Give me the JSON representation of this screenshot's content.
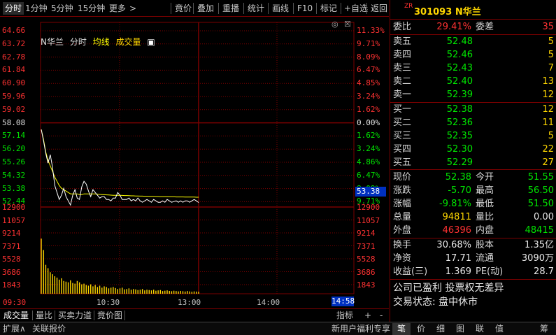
{
  "toolbar": {
    "items": [
      "分时",
      "1分钟",
      "5分钟",
      "15分钟",
      "更多",
      ">",
      "竟价",
      "叠加",
      "重播",
      "统计",
      "画线",
      "F10",
      "标记",
      "+自选",
      "返回"
    ]
  },
  "chart": {
    "legend": {
      "name": "N华兰",
      "mode": "分时",
      "avg": "均线",
      "vol": "成交量"
    },
    "price_labels": [
      "64.66",
      "63.72",
      "62.78",
      "61.84",
      "60.90",
      "59.96",
      "59.02",
      "58.08",
      "57.14",
      "56.20",
      "55.26",
      "54.32",
      "53.38",
      "52.44"
    ],
    "pct_labels": [
      "11.33%",
      "9.71%",
      "8.09%",
      "6.47%",
      "4.85%",
      "3.24%",
      "1.62%",
      "0.00%",
      "1.62%",
      "3.24%",
      "4.86%",
      "6.47%",
      "8.09%",
      "9.71%"
    ],
    "current_price_tag": "53.38",
    "vol_labels": [
      "12900",
      "11057",
      "9214",
      "7371",
      "5528",
      "3686",
      "1843"
    ],
    "vol_labels_right": [
      "12900",
      "11057",
      "9214",
      "7371",
      "5528",
      "3686",
      "1843"
    ],
    "time_labels": [
      "09:30",
      "10:30",
      "13:00",
      "14:00"
    ],
    "current_time_tag": "14:58"
  },
  "chart_data": {
    "type": "line",
    "title": "",
    "series": [
      {
        "name": "分时",
        "values": [
          57.6,
          56.8,
          55.9,
          55.2,
          55.8,
          54.9,
          53.6,
          53.1,
          52.6,
          52.9,
          53.4,
          52.8,
          52.5,
          52.2,
          52.9,
          53.3,
          52.7,
          52.6,
          53.5,
          53.9,
          53.7,
          53.2,
          52.8,
          53.3,
          53.1,
          52.9,
          52.7,
          52.8,
          52.8,
          52.6,
          52.6,
          52.5,
          52.7,
          52.7,
          53.1,
          52.9,
          52.6,
          52.6,
          52.6,
          52.7,
          52.5,
          52.6,
          52.5,
          52.7,
          52.5,
          52.4,
          52.5,
          52.6,
          52.5,
          52.4,
          52.6,
          52.5,
          52.4,
          52.4,
          52.5,
          52.4,
          52.6,
          52.5,
          52.4,
          52.45,
          52.5,
          52.4,
          52.5,
          52.4,
          52.5,
          52.5,
          52.4,
          52.5,
          52.6,
          52.5,
          52.38
        ]
      },
      {
        "name": "均线",
        "values": [
          57.6,
          56.9,
          56.0,
          55.4,
          55.0,
          54.6,
          54.2,
          53.9,
          53.6,
          53.4,
          53.3,
          53.2,
          53.1,
          53.0,
          53.0,
          53.0,
          53.0,
          52.95,
          52.95,
          53.0,
          53.0,
          53.0,
          53.0,
          53.0,
          53.0,
          52.98,
          52.96,
          52.95,
          52.94,
          52.93,
          52.92,
          52.91,
          52.9,
          52.9,
          52.9,
          52.9,
          52.89,
          52.88,
          52.88,
          52.87,
          52.86,
          52.86,
          52.85,
          52.85,
          52.84,
          52.84,
          52.83,
          52.83,
          52.82,
          52.82,
          52.82,
          52.81,
          52.81,
          52.8,
          52.8,
          52.8,
          52.8,
          52.79,
          52.79,
          52.79,
          52.78,
          52.78,
          52.78,
          52.78,
          52.77,
          52.77,
          52.77,
          52.77,
          52.77,
          52.76,
          52.76
        ]
      }
    ],
    "volume": [
      8200,
      6500,
      4300,
      3800,
      3200,
      2900,
      2600,
      2400,
      2100,
      2300,
      1900,
      1800,
      1700,
      2000,
      1600,
      1500,
      1900,
      1700,
      1400,
      1500,
      1300,
      1200,
      1400,
      1100,
      1300,
      1000,
      1200,
      900,
      1100,
      1000,
      800,
      900,
      1000,
      850,
      700,
      800,
      900,
      650,
      700,
      800,
      600,
      700,
      650,
      550,
      600,
      700,
      500,
      600,
      550,
      500,
      600,
      450,
      500,
      550,
      400,
      450,
      500,
      420,
      380,
      450,
      400,
      350,
      420,
      380,
      330,
      400,
      350,
      300,
      350,
      320,
      300
    ],
    "ylim": [
      52.44,
      64.66
    ],
    "prev_close": 58.08,
    "volume_max": 12900,
    "session_length_points": 240
  },
  "panel": {
    "zr": "ZR",
    "code": "301093",
    "name": "N华兰",
    "weibi": {
      "label": "委比",
      "value": "29.41%",
      "label2": "委差",
      "value2": "35"
    },
    "asks": [
      {
        "label": "卖五",
        "price": "52.48",
        "vol": "5"
      },
      {
        "label": "卖四",
        "price": "52.46",
        "vol": "5"
      },
      {
        "label": "卖三",
        "price": "52.43",
        "vol": "7"
      },
      {
        "label": "卖二",
        "price": "52.40",
        "vol": "13"
      },
      {
        "label": "卖一",
        "price": "52.39",
        "vol": "12"
      }
    ],
    "bids": [
      {
        "label": "买一",
        "price": "52.38",
        "vol": "12"
      },
      {
        "label": "买二",
        "price": "52.36",
        "vol": "11"
      },
      {
        "label": "买三",
        "price": "52.35",
        "vol": "5"
      },
      {
        "label": "买四",
        "price": "52.30",
        "vol": "22"
      },
      {
        "label": "买五",
        "price": "52.29",
        "vol": "27"
      }
    ],
    "quote": [
      {
        "l1": "现价",
        "v1": "52.38",
        "c1": "down",
        "l2": "今开",
        "v2": "51.55",
        "c2": "down"
      },
      {
        "l1": "涨跌",
        "v1": "-5.70",
        "c1": "down",
        "l2": "最高",
        "v2": "56.50",
        "c2": "down"
      },
      {
        "l1": "涨幅",
        "v1": "-9.81%",
        "c1": "down",
        "l2": "最低",
        "v2": "51.50",
        "c2": "down"
      },
      {
        "l1": "总量",
        "v1": "94811",
        "c1": "yellow",
        "l2": "量比",
        "v2": "0.00",
        "c2": "white"
      },
      {
        "l1": "外盘",
        "v1": "46396",
        "c1": "up",
        "l2": "内盘",
        "v2": "48415",
        "c2": "down"
      }
    ],
    "fund": [
      {
        "l1": "换手",
        "v1": "30.68%",
        "l2": "股本",
        "v2": "1.35亿"
      },
      {
        "l1": "净资",
        "v1": "17.71",
        "l2": "流通",
        "v2": "3090万"
      },
      {
        "l1": "收益(三)",
        "v1": "1.369",
        "l2": "PE(动)",
        "v2": "28.7"
      }
    ],
    "note1": "公司已盈利 投票权无差异",
    "note2": "交易状态: 盘中休市"
  },
  "bottom_tabs": [
    "成交量",
    "量比",
    "买卖力道",
    "竟价图"
  ],
  "bottom_right": {
    "indicator": "指标",
    "plus": "+",
    "minus": "-"
  },
  "status_bar": {
    "expand": "扩展∧",
    "related": "关联报价",
    "promo": "新用户福利专享",
    "icons": [
      "笔",
      "价",
      "细",
      "图",
      "联",
      "值",
      "筹"
    ]
  },
  "colors": {
    "up": "#ff3232",
    "down": "#00e600",
    "grid": "#7a0000",
    "price_line": "#ffffff",
    "avg_line": "#ffff00",
    "volume_bar": "#ffd700"
  }
}
